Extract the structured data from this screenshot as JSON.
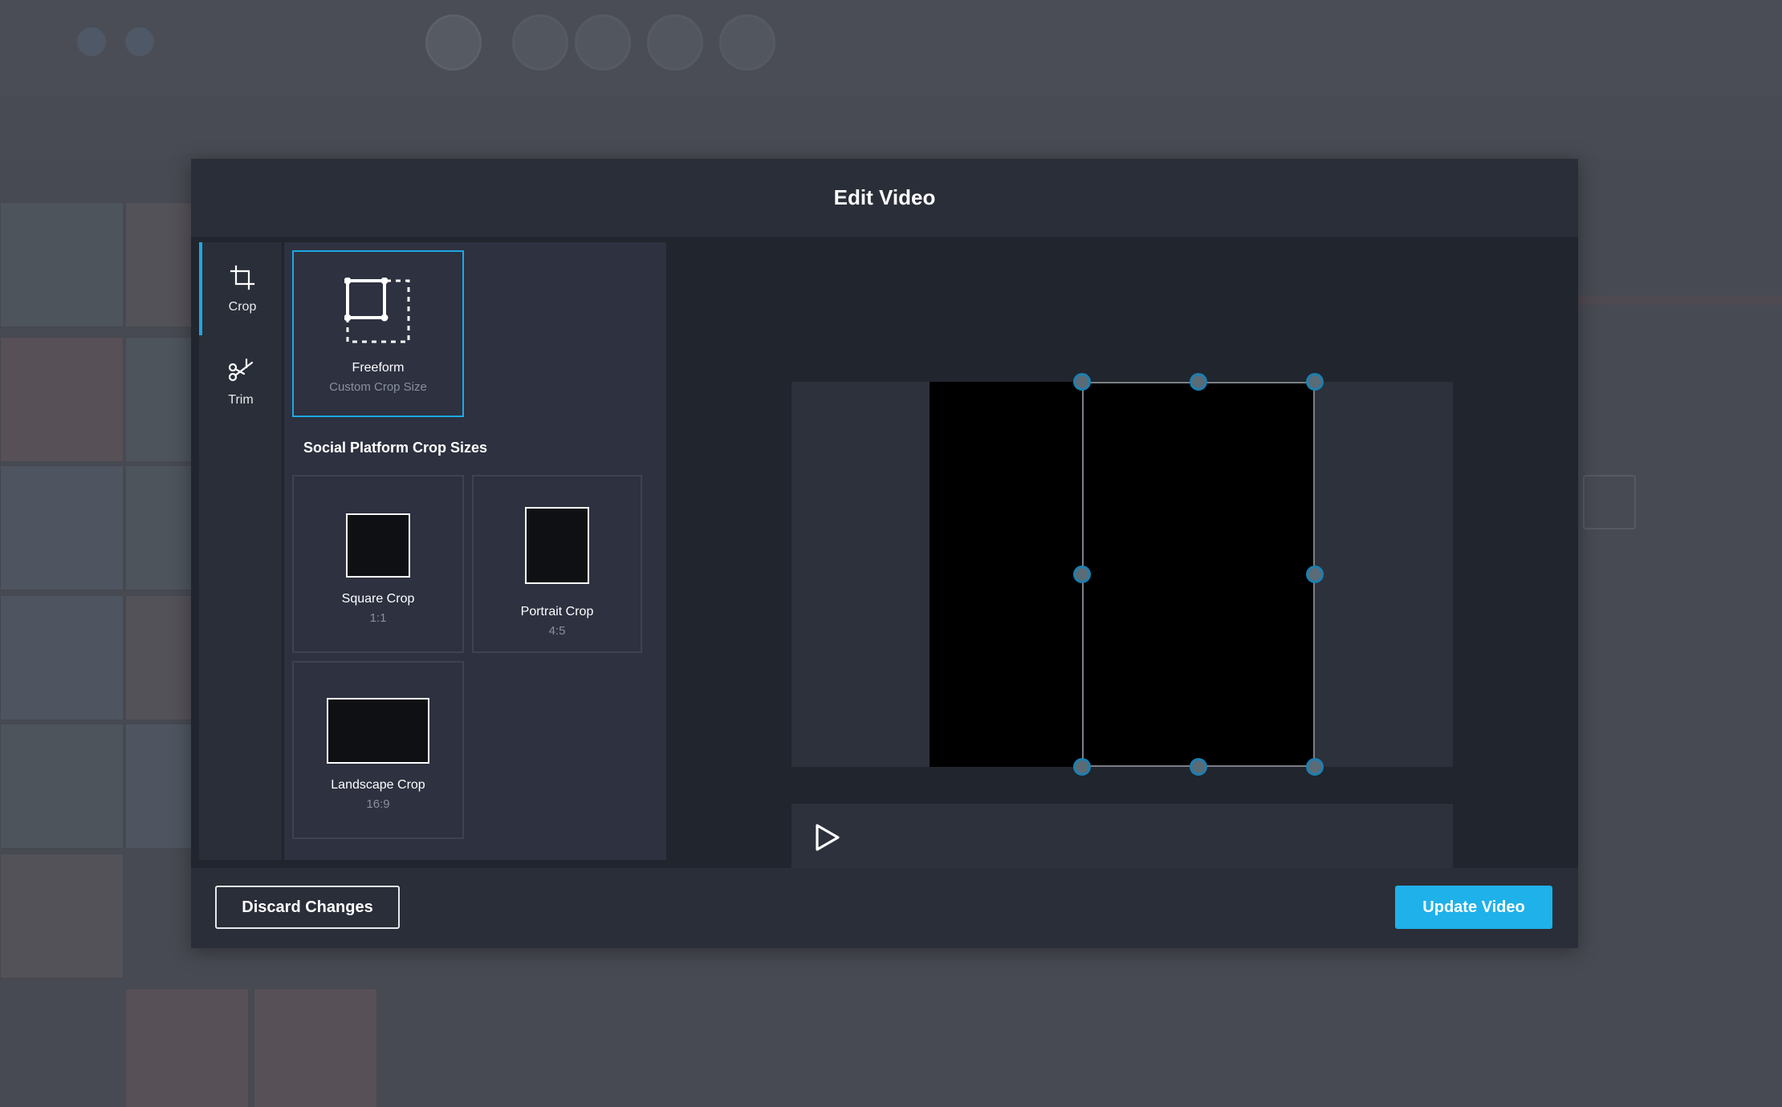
{
  "modal": {
    "title": "Edit Video"
  },
  "tools": [
    {
      "label": "Crop",
      "icon": "crop-icon",
      "active": true
    },
    {
      "label": "Trim",
      "icon": "scissors-icon",
      "active": false
    }
  ],
  "crop_panel": {
    "freeform": {
      "name": "Freeform",
      "subtitle": "Custom Crop Size",
      "selected": true
    },
    "section_title": "Social Platform Crop Sizes",
    "presets": [
      {
        "name": "Square Crop",
        "ratio": "1:1"
      },
      {
        "name": "Portrait Crop",
        "ratio": "4:5"
      },
      {
        "name": "Landscape Crop",
        "ratio": "16:9"
      }
    ]
  },
  "player": {
    "play_icon": "play-icon"
  },
  "footer": {
    "discard_label": "Discard Changes",
    "update_label": "Update Video"
  },
  "colors": {
    "accent": "#1fb1ea",
    "modal_bg": "#2a2e38",
    "body_bg": "#21252d",
    "panel_bg": "#2d3140"
  }
}
